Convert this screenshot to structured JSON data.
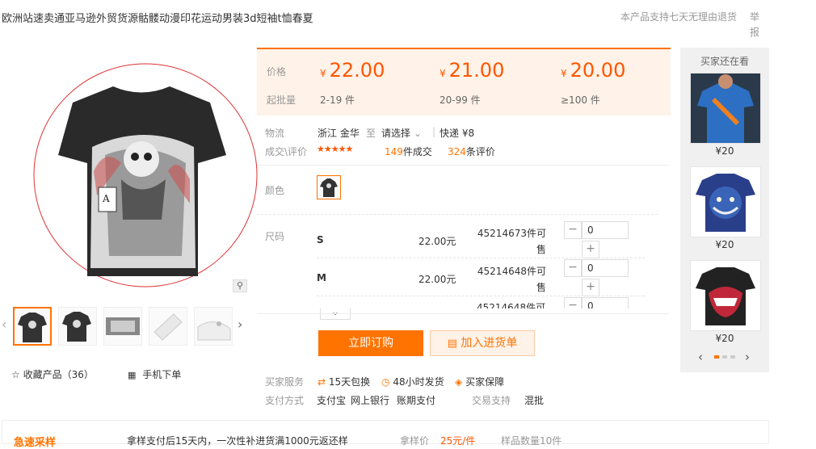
{
  "header": {
    "title": "欧洲站速卖通亚马逊外贸货源骷髅动漫印花运动男装3d短袖t恤春夏",
    "return_policy": "本产品支持七天无理由退货",
    "report": "举报"
  },
  "gallery": {
    "zoom_icon": "magnifier-icon",
    "left_arrow": "‹",
    "right_arrow": "›",
    "favorite_label": "收藏产品（36）",
    "mobile_order_label": "手机下单"
  },
  "price": {
    "price_label": "价格",
    "moq_label": "起批量",
    "currency": "¥",
    "tiers": [
      {
        "price": "22.00",
        "qty": "2-19 件"
      },
      {
        "price": "21.00",
        "qty": "20-99 件"
      },
      {
        "price": "20.00",
        "qty": "≥100 件"
      }
    ]
  },
  "logistics": {
    "label": "物流",
    "from": "浙江 金华",
    "to_word": "至",
    "select": "请选择",
    "express": "快递 ¥8"
  },
  "reviews": {
    "label": "成交\\评价",
    "stars": "★★★★★",
    "deals_count": "149",
    "deals_unit": "件成交",
    "reviews_count": "324",
    "reviews_unit": "条评价"
  },
  "color": {
    "label": "颜色"
  },
  "sizes": {
    "label": "尺码",
    "currency_unit": "元",
    "rows": [
      {
        "size": "S",
        "price": "22.00",
        "stock": "45214673件可售",
        "qty": "0"
      },
      {
        "size": "M",
        "price": "22.00",
        "stock": "45214648件可售",
        "qty": "0"
      },
      {
        "size": "",
        "price": "",
        "stock": "45214648件可",
        "qty": "0"
      }
    ],
    "expand": "⌄"
  },
  "actions": {
    "order_now": "立即订购",
    "add_cart": "加入进货单"
  },
  "service": {
    "label": "买家服务",
    "items": [
      "15天包换",
      "48小时发货",
      "买家保障"
    ]
  },
  "payment": {
    "label": "支付方式",
    "methods": [
      "支付宝",
      "网上银行",
      "账期支付"
    ],
    "trade_label": "交易支持",
    "trade_value": "混批"
  },
  "sidebar": {
    "title": "买家还在看",
    "items": [
      {
        "price": "¥20"
      },
      {
        "price": "¥20"
      },
      {
        "price": "¥20"
      }
    ],
    "prev": "‹",
    "next": "›"
  },
  "bottom": {
    "brand": "急速采样",
    "text1": "拿样支付后15天内，一次性补进货满1000元返还样",
    "sample_price_label": "拿样价",
    "sample_price": "25元/件",
    "sample_qty": "样品数量10件"
  }
}
